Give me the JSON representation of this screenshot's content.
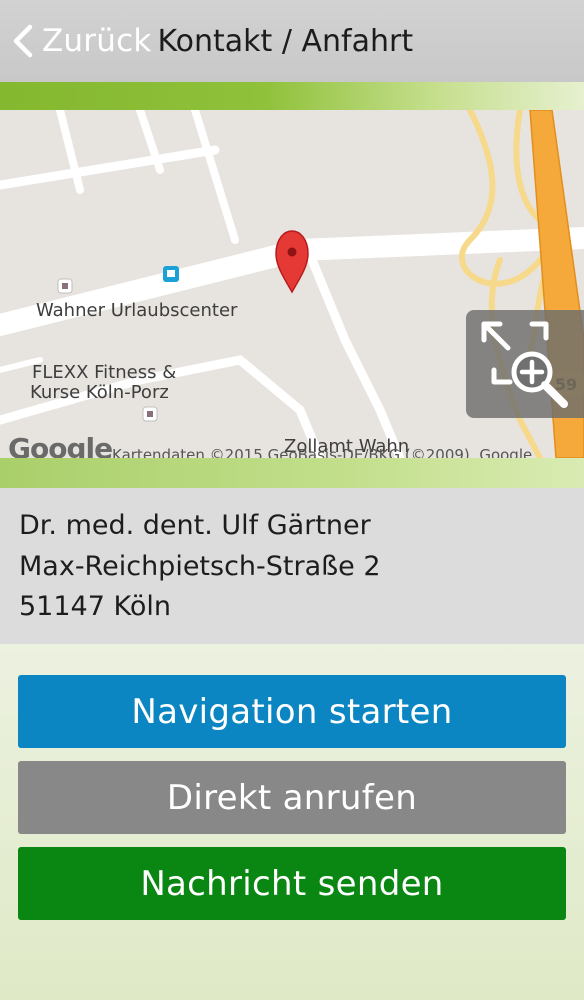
{
  "header": {
    "back_label": "Zurück",
    "title": "Kontakt / Anfahrt"
  },
  "map": {
    "labels": {
      "urlaub": "Wahner Urlaubscenter",
      "flexx_line1": "FLEXX Fitness &",
      "flexx_line2": "Kurse Köln-Porz",
      "zollamt": "Zollamt Wahn",
      "google": "Google",
      "attribution": "Kartendaten ©2015 GeoBasis-DE/BKG (©2009), Google",
      "highway_shield": "59"
    },
    "marker_icon": "map-pin-icon",
    "zoom_icon": "zoom-in-icon"
  },
  "address": {
    "name": "Dr. med. dent. Ulf Gärtner",
    "street": "Max-Reichpietsch-Straße 2",
    "city": "51147 Köln"
  },
  "buttons": {
    "navigation": "Navigation starten",
    "call": "Direkt anrufen",
    "message": "Nachricht senden"
  },
  "colors": {
    "navigation": "#0b86c3",
    "call": "#888888",
    "message": "#0a8612",
    "accent_green": "#84b82f",
    "marker_red": "#e53935"
  }
}
